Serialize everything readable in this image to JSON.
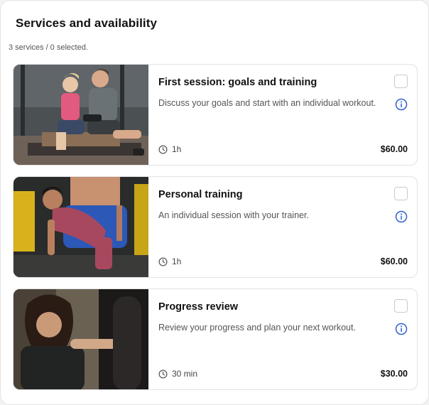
{
  "header": {
    "title": "Services and availability",
    "summary": "3 services / 0 selected."
  },
  "colors": {
    "accent": "#2f5fd0",
    "border": "#e2e2e5",
    "text_muted": "#555555"
  },
  "services": [
    {
      "title": "First session: goals and training",
      "description": "Discuss your goals and start with an individual workout.",
      "duration": "1h",
      "price": "$60.00",
      "selected": false,
      "image": "trainer-and-client-on-bench-photo"
    },
    {
      "title": "Personal training",
      "description": "An individual session with your trainer.",
      "duration": "1h",
      "price": "$60.00",
      "selected": false,
      "image": "woman-stretching-with-trainer-photo"
    },
    {
      "title": "Progress review",
      "description": "Review your progress and plan your next workout.",
      "duration": "30 min",
      "price": "$30.00",
      "selected": false,
      "image": "woman-training-with-heavy-bag-photo"
    }
  ],
  "icons": {
    "info": "info-circle-icon",
    "duration": "clock-icon",
    "select": "checkbox"
  }
}
